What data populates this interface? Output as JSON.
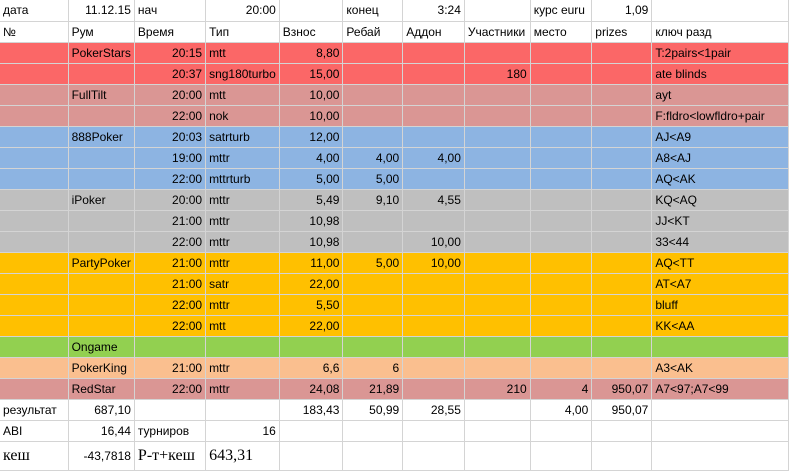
{
  "colors": {
    "red": "#fb6767",
    "rose": "#da9694",
    "blue": "#8db4e2",
    "gray": "#bfbfbf",
    "orange": "#ffc000",
    "green": "#92d050",
    "peach": "#fabf8f",
    "white": "#ffffff"
  },
  "rows": [
    {
      "bg": "white",
      "cells": [
        {
          "t": "дата"
        },
        {
          "t": "11.12.15",
          "n": 1
        },
        {
          "t": "нач"
        },
        {
          "t": "20:00",
          "n": 1
        },
        {
          "t": ""
        },
        {
          "t": "конец"
        },
        {
          "t": "3:24",
          "n": 1
        },
        {
          "t": ""
        },
        {
          "t": "курс euru"
        },
        {
          "t": "1,09",
          "n": 1
        },
        {
          "t": ""
        }
      ]
    },
    {
      "bg": "white",
      "cells": [
        {
          "t": "№"
        },
        {
          "t": "Рум"
        },
        {
          "t": "Время"
        },
        {
          "t": "Тип"
        },
        {
          "t": "Взнос"
        },
        {
          "t": "Ребай"
        },
        {
          "t": "Аддон"
        },
        {
          "t": "Участники"
        },
        {
          "t": "место"
        },
        {
          "t": "prizes"
        },
        {
          "t": "ключ разд"
        }
      ]
    },
    {
      "bg": "red",
      "cells": [
        {
          "t": ""
        },
        {
          "t": "PokerStars"
        },
        {
          "t": "20:15",
          "n": 1
        },
        {
          "t": "mtt"
        },
        {
          "t": "8,80",
          "n": 1
        },
        {
          "t": ""
        },
        {
          "t": ""
        },
        {
          "t": ""
        },
        {
          "t": ""
        },
        {
          "t": ""
        },
        {
          "t": "T:2pairs<1pair"
        }
      ]
    },
    {
      "bg": "red",
      "cells": [
        {
          "t": ""
        },
        {
          "t": ""
        },
        {
          "t": "20:37",
          "n": 1
        },
        {
          "t": "sng180turbo"
        },
        {
          "t": "15,00",
          "n": 1
        },
        {
          "t": ""
        },
        {
          "t": ""
        },
        {
          "t": "180",
          "n": 1
        },
        {
          "t": ""
        },
        {
          "t": ""
        },
        {
          "t": "ate blinds"
        }
      ]
    },
    {
      "bg": "rose",
      "cells": [
        {
          "t": ""
        },
        {
          "t": "FullTilt"
        },
        {
          "t": "20:00",
          "n": 1
        },
        {
          "t": "mtt"
        },
        {
          "t": "10,00",
          "n": 1
        },
        {
          "t": ""
        },
        {
          "t": ""
        },
        {
          "t": ""
        },
        {
          "t": ""
        },
        {
          "t": ""
        },
        {
          "t": "ayt"
        }
      ]
    },
    {
      "bg": "rose",
      "cells": [
        {
          "t": ""
        },
        {
          "t": ""
        },
        {
          "t": "22:00",
          "n": 1
        },
        {
          "t": "nok"
        },
        {
          "t": "10,00",
          "n": 1
        },
        {
          "t": ""
        },
        {
          "t": ""
        },
        {
          "t": ""
        },
        {
          "t": ""
        },
        {
          "t": ""
        },
        {
          "t": "F:fldro<lowfldro+pair"
        }
      ]
    },
    {
      "bg": "blue",
      "cells": [
        {
          "t": ""
        },
        {
          "t": "888Poker"
        },
        {
          "t": "20:03",
          "n": 1
        },
        {
          "t": "satrturb"
        },
        {
          "t": "12,00",
          "n": 1
        },
        {
          "t": ""
        },
        {
          "t": ""
        },
        {
          "t": ""
        },
        {
          "t": ""
        },
        {
          "t": ""
        },
        {
          "t": "AJ<A9"
        }
      ]
    },
    {
      "bg": "blue",
      "cells": [
        {
          "t": ""
        },
        {
          "t": ""
        },
        {
          "t": "19:00",
          "n": 1
        },
        {
          "t": "mttr"
        },
        {
          "t": "4,00",
          "n": 1
        },
        {
          "t": "4,00",
          "n": 1
        },
        {
          "t": "4,00",
          "n": 1
        },
        {
          "t": ""
        },
        {
          "t": ""
        },
        {
          "t": ""
        },
        {
          "t": "A8<AJ"
        }
      ]
    },
    {
      "bg": "blue",
      "cells": [
        {
          "t": ""
        },
        {
          "t": ""
        },
        {
          "t": "22:00",
          "n": 1
        },
        {
          "t": "mttrturb"
        },
        {
          "t": "5,00",
          "n": 1
        },
        {
          "t": "5,00",
          "n": 1
        },
        {
          "t": ""
        },
        {
          "t": ""
        },
        {
          "t": ""
        },
        {
          "t": ""
        },
        {
          "t": "AQ<AK"
        }
      ]
    },
    {
      "bg": "gray",
      "cells": [
        {
          "t": ""
        },
        {
          "t": "iPoker"
        },
        {
          "t": "20:00",
          "n": 1
        },
        {
          "t": "mttr"
        },
        {
          "t": "5,49",
          "n": 1
        },
        {
          "t": "9,10",
          "n": 1
        },
        {
          "t": "4,55",
          "n": 1
        },
        {
          "t": ""
        },
        {
          "t": ""
        },
        {
          "t": ""
        },
        {
          "t": "KQ<AQ"
        }
      ]
    },
    {
      "bg": "gray",
      "cells": [
        {
          "t": ""
        },
        {
          "t": ""
        },
        {
          "t": "21:00",
          "n": 1
        },
        {
          "t": "mttr"
        },
        {
          "t": "10,98",
          "n": 1
        },
        {
          "t": ""
        },
        {
          "t": ""
        },
        {
          "t": ""
        },
        {
          "t": ""
        },
        {
          "t": ""
        },
        {
          "t": "JJ<KT"
        }
      ]
    },
    {
      "bg": "gray",
      "cells": [
        {
          "t": ""
        },
        {
          "t": ""
        },
        {
          "t": "22:00",
          "n": 1
        },
        {
          "t": "mttr"
        },
        {
          "t": "10,98",
          "n": 1
        },
        {
          "t": ""
        },
        {
          "t": "10,00",
          "n": 1
        },
        {
          "t": ""
        },
        {
          "t": ""
        },
        {
          "t": ""
        },
        {
          "t": "33<44"
        }
      ]
    },
    {
      "bg": "orange",
      "cells": [
        {
          "t": ""
        },
        {
          "t": "PartyPoker"
        },
        {
          "t": "21:00",
          "n": 1
        },
        {
          "t": "mttr"
        },
        {
          "t": "11,00",
          "n": 1
        },
        {
          "t": "5,00",
          "n": 1
        },
        {
          "t": "10,00",
          "n": 1
        },
        {
          "t": ""
        },
        {
          "t": ""
        },
        {
          "t": ""
        },
        {
          "t": "AQ<TT"
        }
      ]
    },
    {
      "bg": "orange",
      "cells": [
        {
          "t": ""
        },
        {
          "t": ""
        },
        {
          "t": "21:00",
          "n": 1
        },
        {
          "t": "satr"
        },
        {
          "t": "22,00",
          "n": 1
        },
        {
          "t": ""
        },
        {
          "t": ""
        },
        {
          "t": ""
        },
        {
          "t": ""
        },
        {
          "t": ""
        },
        {
          "t": "AT<A7"
        }
      ]
    },
    {
      "bg": "orange",
      "cells": [
        {
          "t": ""
        },
        {
          "t": ""
        },
        {
          "t": "22:00",
          "n": 1
        },
        {
          "t": "mttr"
        },
        {
          "t": "5,50",
          "n": 1
        },
        {
          "t": ""
        },
        {
          "t": ""
        },
        {
          "t": ""
        },
        {
          "t": ""
        },
        {
          "t": ""
        },
        {
          "t": "bluff"
        }
      ]
    },
    {
      "bg": "orange",
      "cells": [
        {
          "t": ""
        },
        {
          "t": ""
        },
        {
          "t": "22:00",
          "n": 1
        },
        {
          "t": "mtt"
        },
        {
          "t": "22,00",
          "n": 1
        },
        {
          "t": ""
        },
        {
          "t": ""
        },
        {
          "t": ""
        },
        {
          "t": ""
        },
        {
          "t": ""
        },
        {
          "t": "KK<AA"
        }
      ]
    },
    {
      "bg": "green",
      "cells": [
        {
          "t": ""
        },
        {
          "t": "Ongame"
        },
        {
          "t": ""
        },
        {
          "t": ""
        },
        {
          "t": ""
        },
        {
          "t": ""
        },
        {
          "t": ""
        },
        {
          "t": ""
        },
        {
          "t": ""
        },
        {
          "t": ""
        },
        {
          "t": ""
        }
      ]
    },
    {
      "bg": "peach",
      "cells": [
        {
          "t": ""
        },
        {
          "t": "PokerKing"
        },
        {
          "t": "21:00",
          "n": 1
        },
        {
          "t": "mttr"
        },
        {
          "t": "6,6",
          "n": 1
        },
        {
          "t": "6",
          "n": 1
        },
        {
          "t": ""
        },
        {
          "t": ""
        },
        {
          "t": ""
        },
        {
          "t": ""
        },
        {
          "t": "A3<AK"
        }
      ]
    },
    {
      "bg": "rose",
      "cells": [
        {
          "t": ""
        },
        {
          "t": "RedStar"
        },
        {
          "t": "22:00",
          "n": 1
        },
        {
          "t": "mttr"
        },
        {
          "t": "24,08",
          "n": 1
        },
        {
          "t": "21,89",
          "n": 1
        },
        {
          "t": ""
        },
        {
          "t": "210",
          "n": 1
        },
        {
          "t": "4",
          "n": 1
        },
        {
          "t": "950,07",
          "n": 1
        },
        {
          "t": "A7<97;A7<99"
        }
      ]
    },
    {
      "bg": "white",
      "cells": [
        {
          "t": "результат"
        },
        {
          "t": "687,10",
          "n": 1
        },
        {
          "t": ""
        },
        {
          "t": ""
        },
        {
          "t": "183,43",
          "n": 1
        },
        {
          "t": "50,99",
          "n": 1
        },
        {
          "t": "28,55",
          "n": 1
        },
        {
          "t": ""
        },
        {
          "t": "4,00",
          "n": 1
        },
        {
          "t": "950,07",
          "n": 1
        },
        {
          "t": ""
        }
      ]
    },
    {
      "bg": "white",
      "cells": [
        {
          "t": "ABI"
        },
        {
          "t": "16,44",
          "n": 1
        },
        {
          "t": "турниров"
        },
        {
          "t": "16",
          "n": 1
        },
        {
          "t": ""
        },
        {
          "t": ""
        },
        {
          "t": ""
        },
        {
          "t": ""
        },
        {
          "t": ""
        },
        {
          "t": ""
        },
        {
          "t": ""
        }
      ]
    },
    {
      "bg": "white",
      "cells": [
        {
          "t": "кеш",
          "big": 1
        },
        {
          "t": "-43,7818",
          "n": 1
        },
        {
          "t": "Р-т+кеш",
          "big": 1
        },
        {
          "t": "643,31",
          "big": 1
        },
        {
          "t": ""
        },
        {
          "t": ""
        },
        {
          "t": ""
        },
        {
          "t": ""
        },
        {
          "t": ""
        },
        {
          "t": ""
        },
        {
          "t": ""
        }
      ]
    }
  ]
}
